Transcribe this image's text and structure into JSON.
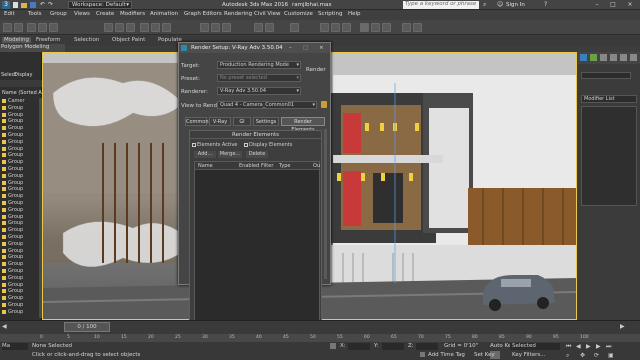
{
  "titlebar": {
    "workspace": "Workspace: Default",
    "title": "Autodesk 3ds Max 2016",
    "filename": "ramjibhai.max",
    "search_placeholder": "Type a keyword or phrase",
    "sign_in": "Sign In"
  },
  "menu": [
    "Edit",
    "Tools",
    "Group",
    "Views",
    "Create",
    "Modifiers",
    "Animation",
    "Graph Editors",
    "Rendering",
    "Civil View",
    "Customize",
    "Scripting",
    "Help"
  ],
  "ribbon": {
    "tabs": [
      "Modeling",
      "Freeform",
      "Selection",
      "Object Paint",
      "Populate"
    ],
    "panel_label": "Polygon Modeling"
  },
  "explorer": {
    "tabs": [
      "Select",
      "Display"
    ],
    "header": "Name (Sorted Ascen",
    "items": [
      "Camer",
      "Group",
      "Group",
      "Group",
      "Group",
      "Group",
      "Group",
      "Group",
      "Group",
      "Group",
      "Group",
      "Group",
      "Group",
      "Group",
      "Group",
      "Group",
      "Group",
      "Group",
      "Group",
      "Group",
      "Group",
      "Group",
      "Group",
      "Group",
      "Group",
      "Group",
      "Group",
      "Group",
      "Group",
      "Group",
      "Group",
      "Group"
    ]
  },
  "dialog": {
    "title": "Render Setup: V-Ray Adv 3.50.04",
    "target_label": "Target:",
    "target_value": "Production Rendering Mode",
    "preset_label": "Preset:",
    "preset_value": "No preset selected",
    "renderer_label": "Renderer:",
    "renderer_value": "V-Ray Adv 3.50.04",
    "render_button": "Render",
    "view_label": "View to Render:",
    "view_value": "Quad 4 - Camera_Common01",
    "tabs": [
      "Common",
      "V-Ray",
      "GI",
      "Settings",
      "Render Elements"
    ],
    "group_title": "Render Elements",
    "elements_active": "Elements Active",
    "display_elements": "Display Elements",
    "add_button": "Add...",
    "merge_button": "Merge...",
    "delete_button": "Delete",
    "columns": [
      "Name",
      "Enabled",
      "Filter",
      "Type",
      "Ou"
    ]
  },
  "cmdpanel": {
    "modifier_list": "Modifier List"
  },
  "timeline": {
    "frame_display": "0 / 100",
    "ticks": [
      "0",
      "5",
      "10",
      "15",
      "20",
      "25",
      "30",
      "35",
      "40",
      "45",
      "50",
      "55",
      "60",
      "65",
      "70",
      "75",
      "80",
      "85",
      "90",
      "95",
      "100"
    ]
  },
  "status": {
    "selection": "None Selected",
    "prompt": "Click or click-and-drag to select objects",
    "x_label": "X:",
    "y_label": "Y:",
    "z_label": "Z:",
    "grid": "Grid = 0'10\"",
    "auto_key": "Auto Key",
    "set_key": "Set Key",
    "selected": "Selected",
    "key_filters": "Key Filters...",
    "add_time_tag": "Add Time Tag",
    "script_label": "Ma"
  }
}
